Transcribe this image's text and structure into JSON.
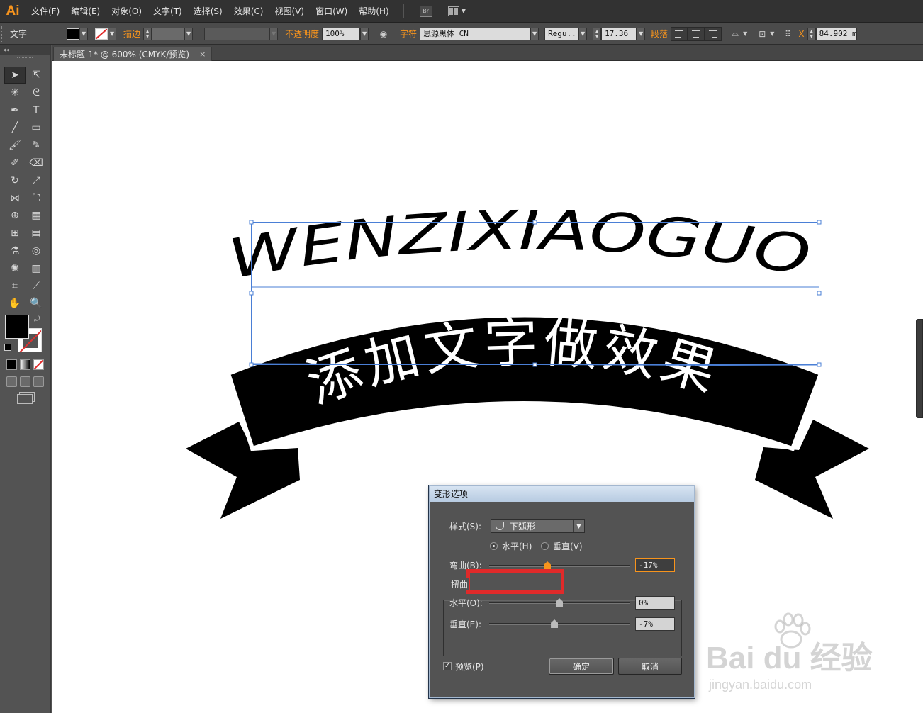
{
  "app": {
    "logo": "Ai"
  },
  "menu": [
    "文件(F)",
    "编辑(E)",
    "对象(O)",
    "文字(T)",
    "选择(S)",
    "效果(C)",
    "视图(V)",
    "窗口(W)",
    "帮助(H)"
  ],
  "bridge_label": "Br",
  "control_bar": {
    "object_type": "文字",
    "stroke_label": "描边",
    "opacity_label": "不透明度",
    "opacity_value": "100%",
    "char_label": "字符",
    "font_family": "思源黑体 CN",
    "font_style": "Regu...",
    "font_size": "17.36",
    "para_label": "段落",
    "x_label": "X",
    "x_value": "84.902 m"
  },
  "document_tab": {
    "title": "未标题-1* @ 600% (CMYK/预览)",
    "close": "×"
  },
  "artwork": {
    "top_text": "WENZIXIAOGUO",
    "banner_text": "添加文字做效果"
  },
  "dialog": {
    "title": "变形选项",
    "style_label": "样式(S):",
    "style_value": "下弧形",
    "horizontal_label": "水平(H)",
    "vertical_label": "垂直(V)",
    "orientation_selected": "horizontal",
    "bend_label": "弯曲(B):",
    "bend_value": "-17%",
    "bend_fraction": 0.415,
    "distortion_label": "扭曲",
    "dist_h_label": "水平(O):",
    "dist_h_value": "0%",
    "dist_h_fraction": 0.5,
    "dist_v_label": "垂直(E):",
    "dist_v_value": "-7%",
    "dist_v_fraction": 0.465,
    "preview_label": "预览(P)",
    "preview_checked": true,
    "ok_label": "确定",
    "cancel_label": "取消"
  },
  "watermark": {
    "brand": "Bai du 经验",
    "url": "jingyan.baidu.com"
  },
  "colors": {
    "accent": "#f7941d",
    "highlight_box": "#e02a2a",
    "selection": "#4a7fd6"
  }
}
